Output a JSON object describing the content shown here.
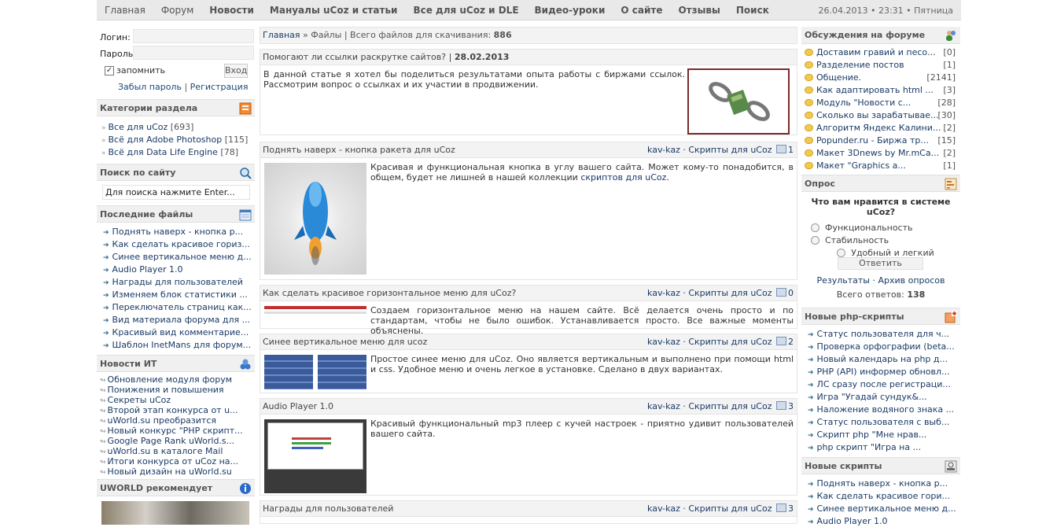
{
  "topnav": {
    "items": [
      "Главная",
      "Форум",
      "Новости",
      "Мануалы uCoz и статьи",
      "Все для uCoz и DLE",
      "Видео-уроки",
      "О сайте",
      "Отзывы",
      "Поиск"
    ],
    "date": "26.04.2013 • 23:31 • Пятница"
  },
  "login": {
    "login_label": "Логин:",
    "password_label": "Пароль:",
    "remember": "запомнить",
    "submit": "Вход",
    "forgot": "Забыл пароль",
    "sep": "|",
    "register": "Регистрация"
  },
  "categories": {
    "title": "Категории раздела",
    "items": [
      {
        "label": "Все для uCoz",
        "count": "[693]"
      },
      {
        "label": "Всё для Adobe Photoshop",
        "count": "[115]"
      },
      {
        "label": "Всё для Data Life Engine",
        "count": "[78]"
      }
    ]
  },
  "search": {
    "title": "Поиск по сайту",
    "placeholder": "Для поиска нажмите Enter..."
  },
  "latest_files": {
    "title": "Последние файлы",
    "items": [
      "Поднять наверх - кнопка р...",
      "Как сделать красивое гориз...",
      "Синее вертикальное меню д...",
      "Audio Player 1.0",
      "Награды для пользователей",
      "Изменяем блок статистики ...",
      "Переключатель страниц как...",
      "Вид материала форума для ...",
      "Красивый вид комментарие...",
      "Шаблон InetMans для форум..."
    ]
  },
  "it_news": {
    "title": "Новости ИТ",
    "items": [
      "Обновление модуля форум",
      "Понижения и повышения",
      "Секреты uCoz",
      "Второй этап конкурса от u...",
      "uWorld.su преобразится",
      "Новый конкурс \"PHP скрипт...",
      "Google Page Rank uWorld.s...",
      "uWorld.su в каталоге Mail",
      "Итоги конкурса от uCoz на...",
      "Новый дизайн на uWorld.su"
    ]
  },
  "recommend": {
    "title": "UWORLD рекомендует"
  },
  "breadcrumbs": {
    "home": "Главная",
    "sep": " » ",
    "section": "Файлы | Всего файлов для скачивания:",
    "count": "886"
  },
  "featured": {
    "title": "Помогают ли ссылки раскрутке сайтов?",
    "sep": " | ",
    "date": "28.02.2013",
    "text": "В данной статье я хотел бы поделиться результатами опыта работы с биржами ссылок. Рассмотрим вопрос о ссылках и их участии в продвижении."
  },
  "posts": [
    {
      "title": "Поднять наверх - кнопка ракета для uCoz",
      "author": "kav-kaz",
      "category": "Скрипты для uCoz",
      "likes": "1",
      "text": "Красивая и функциональная кнопка в углу вашего сайта. Может кому-то понадобится, в общем, будет не лишней в нашей коллекции ",
      "link": "скриптов для uCoz",
      "tail": "."
    },
    {
      "title": "Как сделать красивое горизонтальное меню для uCoz?",
      "author": "kav-kaz",
      "category": "Скрипты для uCoz",
      "likes": "0",
      "text": "Создаем горизонтальное меню на нашем сайте. Всё делается очень просто и по стандартам, чтобы не было ошибок. Устанавливается просто. Все важные моменты объяснены."
    },
    {
      "title": "Синее вертикальное меню для ucoz",
      "author": "kav-kaz",
      "category": "Скрипты для uCoz",
      "likes": "2",
      "text": "Простое синее меню для uCoz. Оно является вертикальным и выполнено при помощи html и css. Удобное меню и очень легкое в установке. Сделано в двух вариантах."
    },
    {
      "title": "Audio Player 1.0",
      "author": "kav-kaz",
      "category": "Скрипты для uCoz",
      "likes": "3",
      "text": "Красивый функциональный mp3 плеер с кучей настроек - приятно удивит пользователей вашего сайта."
    },
    {
      "title": "Награды для пользователей",
      "author": "kav-kaz",
      "category": "Скрипты для uCoz",
      "likes": "3"
    }
  ],
  "forum": {
    "title": "Обсуждения на форуме",
    "items": [
      {
        "label": "Доставим гравий и песо...",
        "count": "[0]"
      },
      {
        "label": "Разделение постов",
        "count": "[1]"
      },
      {
        "label": "Общение.",
        "count": "[2141]"
      },
      {
        "label": "Как адаптировать html ...",
        "count": "[3]"
      },
      {
        "label": "Модуль \"Новости с...",
        "count": "[28]"
      },
      {
        "label": "Сколько вы зарабатывае...",
        "count": "[30]"
      },
      {
        "label": "Алгоритм Яндекс Калини...",
        "count": "[2]"
      },
      {
        "label": "Popunder.ru - Биржа тр...",
        "count": "[15]"
      },
      {
        "label": "Макет 3Dnews by Mr.mCa...",
        "count": "[2]"
      },
      {
        "label": "Макет \"Graphics a...",
        "count": "[1]"
      }
    ]
  },
  "poll": {
    "title": "Опрос",
    "question": "Что вам нравится в системе uCoz?",
    "options": [
      "Функциональность",
      "Стабильность",
      "Удобный и легкий интерфейс"
    ],
    "answer": "Ответить",
    "results": "Результаты",
    "dot": " · ",
    "archive": "Архив опросов",
    "total_label": "Всего ответов:",
    "total": "138"
  },
  "php_scripts": {
    "title": "Новые php-скрипты",
    "items": [
      "Статус пользователя для ч...",
      "Проверка орфографии (beta...",
      "Новый календарь на php д...",
      "PHP (API) информер обновл...",
      "ЛС сразу после регистраци...",
      "Игра \"Угадай сундук&...",
      "Наложение водяного знака ...",
      "Статус пользователя с выб...",
      "Скрипт php \"Мне нрав...",
      "php скрипт \"Игра на ..."
    ]
  },
  "new_scripts": {
    "title": "Новые скрипты",
    "items": [
      "Поднять наверх - кнопка р...",
      "Как сделать красивое гори...",
      "Синее вертикальное меню д...",
      "Audio Player 1.0"
    ]
  },
  "colors": {
    "link": "#1a3a66",
    "header_bg": "#f0f0f0",
    "topbar_bg": "#e9e9e9"
  }
}
